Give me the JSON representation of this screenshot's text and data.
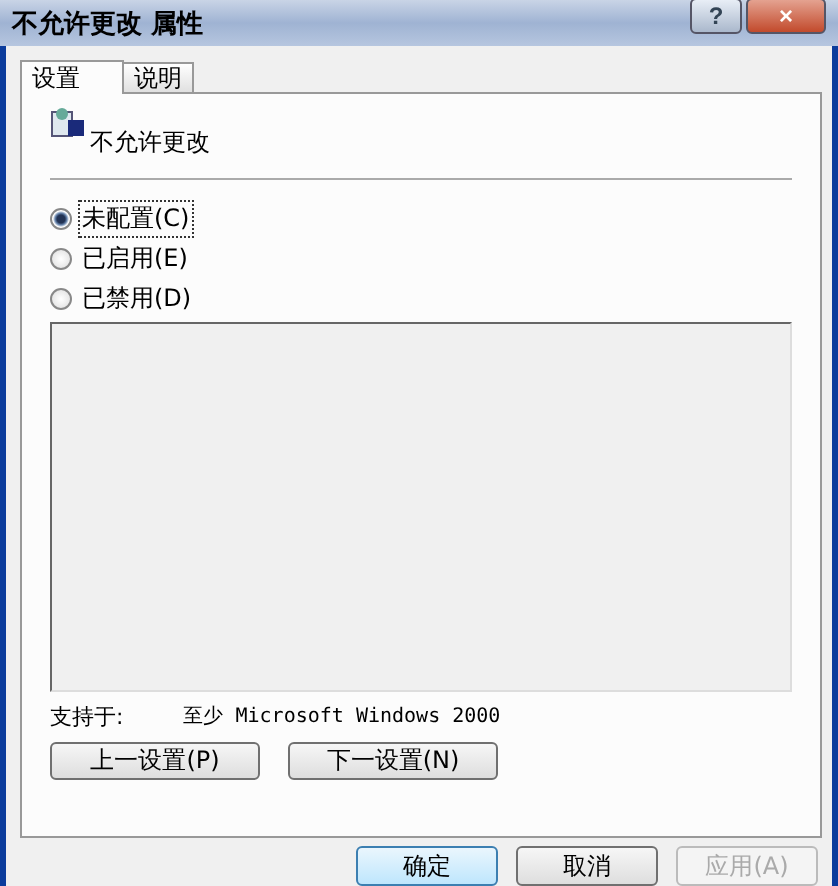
{
  "window": {
    "title": "不允许更改 属性",
    "help_button": "?",
    "close_button": "×"
  },
  "tabs": [
    {
      "label": "设置",
      "selected": true
    },
    {
      "label": "说明",
      "selected": false
    }
  ],
  "setting": {
    "name": "不允许更改"
  },
  "options": [
    {
      "label": "未配置(C)",
      "selected": true
    },
    {
      "label": "已启用(E)",
      "selected": false
    },
    {
      "label": "已禁用(D)",
      "selected": false
    }
  ],
  "supported": {
    "label": "支持于:",
    "value": "至少 Microsoft Windows 2000"
  },
  "nav_buttons": [
    {
      "label": "上一设置(P)",
      "disabled": false
    },
    {
      "label": "下一设置(N)",
      "disabled": false
    }
  ],
  "buttons": [
    {
      "label": "确定",
      "disabled": false
    },
    {
      "label": "取消",
      "disabled": false
    },
    {
      "label": "应用(A)",
      "disabled": true
    }
  ]
}
